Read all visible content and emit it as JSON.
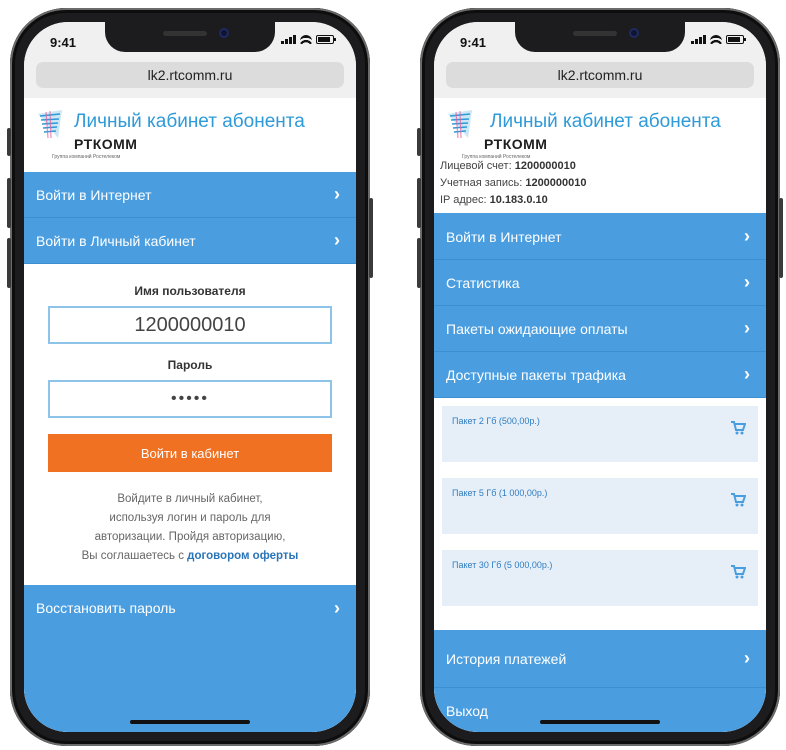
{
  "left_phone": {
    "status": {
      "time": "9:41"
    },
    "url": "lk2.rtcomm.ru",
    "logo": {
      "title": "Личный кабинет абонента",
      "brand": "РТКОММ",
      "tagline": "Группа компаний Ростелеком"
    },
    "menu": [
      {
        "label": "Войти в Интернет"
      },
      {
        "label": "Войти в Личный кабинет"
      }
    ],
    "form": {
      "username_label": "Имя пользователя",
      "username_value": "1200000010",
      "password_label": "Пароль",
      "password_value": "•••••",
      "submit_label": "Войти в кабинет"
    },
    "hint": {
      "line1": "Войдите в личный кабинет,",
      "line2": "используя логин и пароль для",
      "line3": "авторизации. Пройдя авторизацию,",
      "line4_prefix": "Вы соглашаетесь с ",
      "link": "договором оферты"
    },
    "recover": {
      "label": "Восстановить пароль"
    }
  },
  "right_phone": {
    "status": {
      "time": "9:41"
    },
    "url": "lk2.rtcomm.ru",
    "logo": {
      "title": "Личный кабинет абонента",
      "brand": "РТКОММ",
      "tagline": "Группа компаний Ростелеком"
    },
    "account": {
      "account_label": "Лицевой счет:",
      "account_value": "1200000010",
      "login_label": "Учетная запись:",
      "login_value": "1200000010",
      "ip_label": "IP адрес:",
      "ip_value": "10.183.0.10"
    },
    "menu": [
      {
        "label": "Войти в Интернет"
      },
      {
        "label": "Статистика"
      },
      {
        "label": "Пакеты ожидающие оплаты"
      },
      {
        "label": "Доступные пакеты трафика"
      }
    ],
    "packages": [
      {
        "name": "Пакет 2 Гб (500,00р.)"
      },
      {
        "name": "Пакет 5 Гб (1 000,00р.)"
      },
      {
        "name": "Пакет 30 Гб (5 000,00р.)"
      }
    ],
    "bottom_menu": [
      {
        "label": "История платежей"
      },
      {
        "label": "Выход"
      }
    ]
  },
  "colors": {
    "menu_blue": "#4a9ee0",
    "button_orange": "#f07122",
    "logo_blue": "#2e9ad8"
  }
}
